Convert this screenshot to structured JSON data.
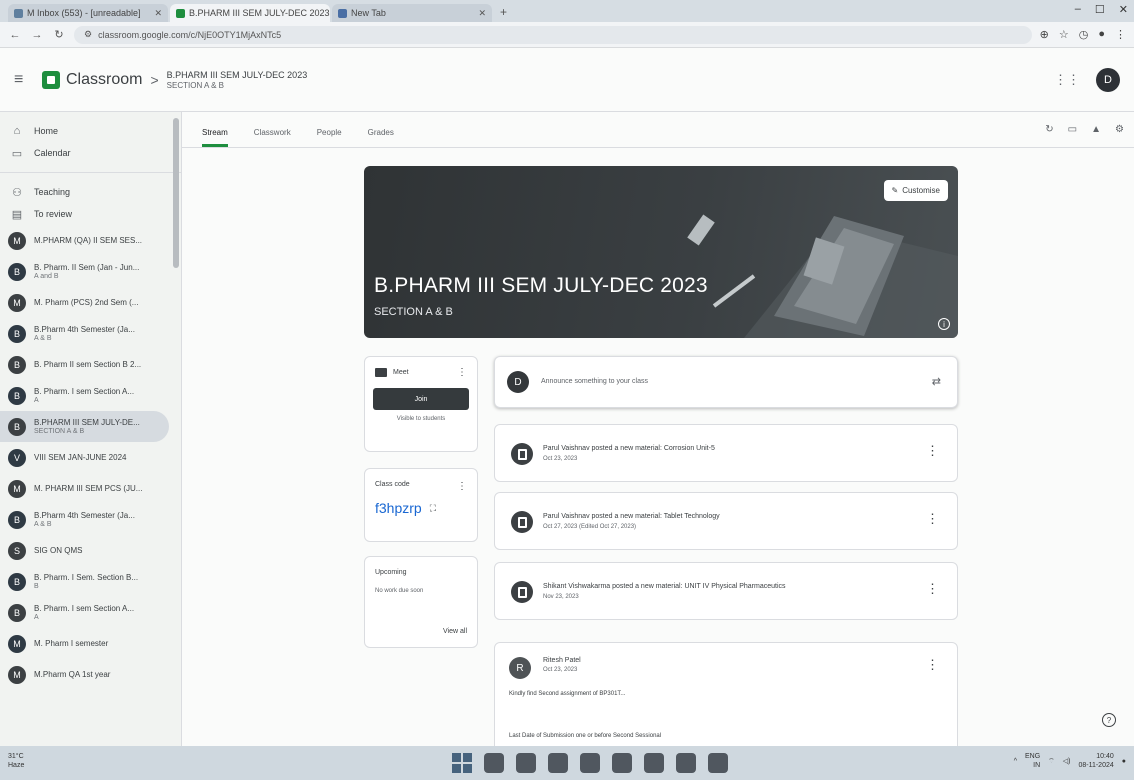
{
  "browser": {
    "tabs": [
      {
        "label": "M Inbox (553) - [unreadable]",
        "active": false
      },
      {
        "label": "B.PHARM III SEM JULY-DEC 2023",
        "active": true
      },
      {
        "label": "New Tab",
        "active": false
      }
    ],
    "new_tab": "+",
    "url": "classroom.google.com/c/NjE0OTY1MjAxNTc5"
  },
  "header": {
    "app_name": "Classroom",
    "crumb_separator": ">",
    "class_title": "B.PHARM III SEM JULY-DEC 2023",
    "class_section": "SECTION A & B",
    "avatar_letter": "D"
  },
  "sidebar": {
    "home": "Home",
    "calendar": "Calendar",
    "teaching": "Teaching",
    "to_review": "To review",
    "classes": [
      {
        "letter": "M",
        "name": "M.PHARM (QA) II SEM SES...",
        "sub": "",
        "color": "#3c4043"
      },
      {
        "letter": "B",
        "name": "B. Pharm. II Sem (Jan - Jun...",
        "sub": "A and B",
        "color": "#2f3a44"
      },
      {
        "letter": "M",
        "name": "M. Pharm (PCS) 2nd Sem (...",
        "sub": "",
        "color": "#3c4043"
      },
      {
        "letter": "B",
        "name": "B.Pharm 4th Semester (Ja...",
        "sub": "A & B",
        "color": "#2f3a44"
      },
      {
        "letter": "B",
        "name": "B. Pharm II sem Section B 2...",
        "sub": "",
        "color": "#3c4043"
      },
      {
        "letter": "B",
        "name": "B. Pharm. I sem Section A...",
        "sub": "A",
        "color": "#2f3a44"
      },
      {
        "letter": "B",
        "name": "B.PHARM III SEM JULY-DE...",
        "sub": "SECTION A & B",
        "color": "#3c4043"
      },
      {
        "letter": "V",
        "name": "VIII SEM JAN-JUNE 2024",
        "sub": "",
        "color": "#2f3a44"
      },
      {
        "letter": "M",
        "name": "M. PHARM III SEM PCS (JU...",
        "sub": "",
        "color": "#3c4043"
      },
      {
        "letter": "B",
        "name": "B.Pharm 4th Semester (Ja...",
        "sub": "A & B",
        "color": "#2f3a44"
      },
      {
        "letter": "S",
        "name": "SIG ON QMS",
        "sub": "",
        "color": "#3c4043"
      },
      {
        "letter": "B",
        "name": "B. Pharm. I Sem. Section B...",
        "sub": "B",
        "color": "#2f3a44"
      },
      {
        "letter": "B",
        "name": "B. Pharm. I sem Section A...",
        "sub": "A",
        "color": "#3c4043"
      },
      {
        "letter": "M",
        "name": "M. Pharm I semester",
        "sub": "",
        "color": "#2f3a44"
      },
      {
        "letter": "M",
        "name": "M.Pharm QA 1st year",
        "sub": "",
        "color": "#3c4043"
      }
    ]
  },
  "class_tabs": [
    "Stream",
    "Classwork",
    "People",
    "Grades"
  ],
  "banner": {
    "title": "B.PHARM III SEM JULY-DEC 2023",
    "section": "SECTION A & B",
    "customise": "Customise"
  },
  "meet": {
    "label": "Meet",
    "join": "Join",
    "visible": "Visible to students"
  },
  "class_code": {
    "label": "Class code",
    "code": "f3hpzrp"
  },
  "upcoming": {
    "label": "Upcoming",
    "none": "No work due soon",
    "view_all": "View all"
  },
  "stream": {
    "announce_avatar": "D",
    "announce_placeholder": "Announce something to your class",
    "posts": [
      {
        "title": "Parul Vaishnav posted a new material: Corrosion Unit-5",
        "date": "Oct 23, 2023"
      },
      {
        "title": "Parul Vaishnav posted a new material: Tablet Technology",
        "date": "Oct 27, 2023 (Edited Oct 27, 2023)"
      },
      {
        "title": "Shikant Vishwakarma posted a new material: UNIT IV Physical Pharmaceutics",
        "date": "Nov 23, 2023"
      }
    ],
    "reply_post": {
      "avatar": "R",
      "name": "Ritesh Patel",
      "date": "Oct 23, 2023",
      "line1": "Kindly find Second assignment of BP301T...",
      "line2": "Last Date of Submission one or before Second Sessional"
    }
  },
  "taskbar": {
    "temp": "31°C",
    "weather": "Haze",
    "lang": "ENG",
    "lang_sub": "IN",
    "time": "10:40",
    "date": "08-11-2024"
  }
}
